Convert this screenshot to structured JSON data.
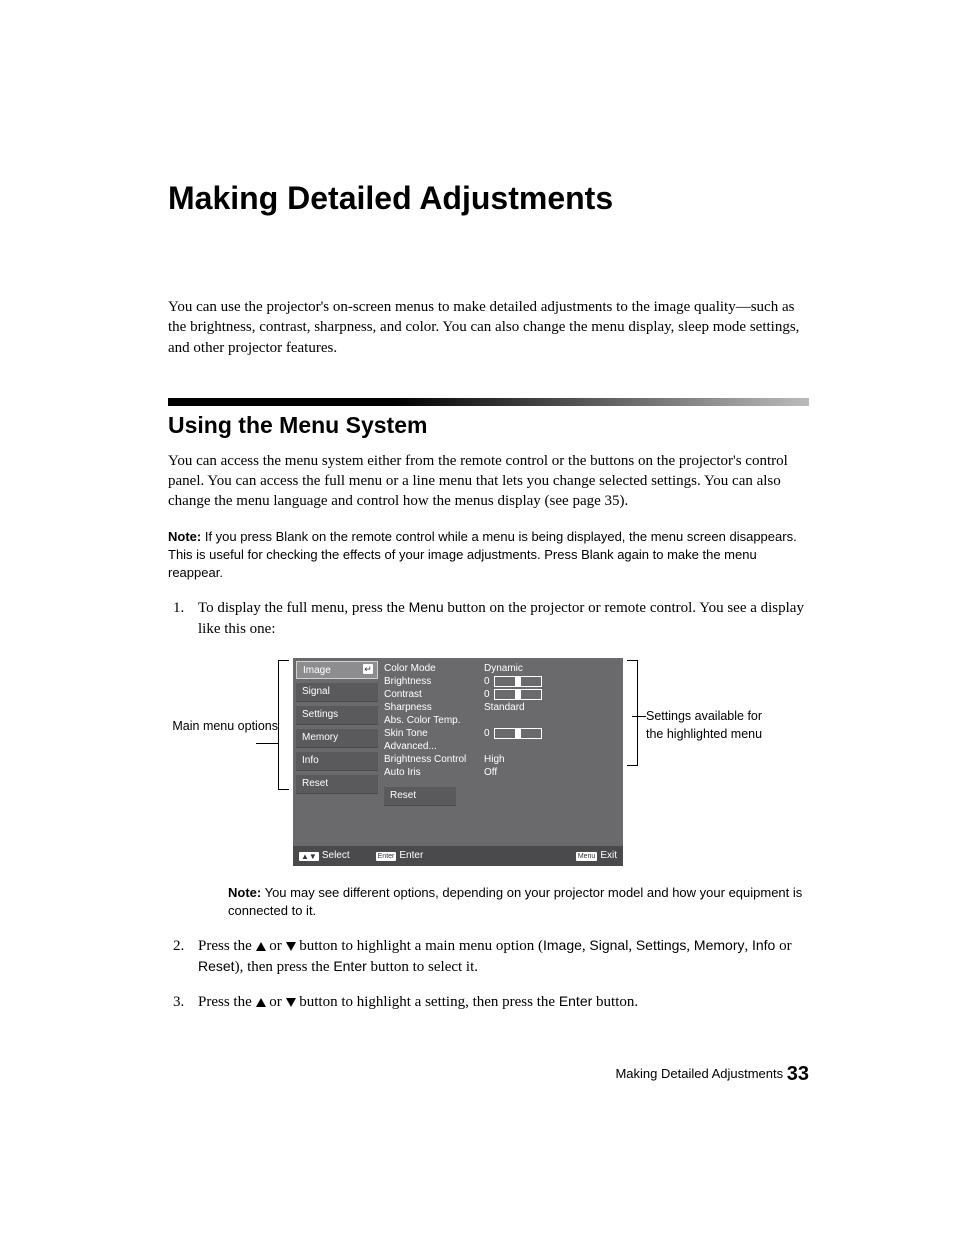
{
  "h1": "Making Detailed Adjustments",
  "intro": "You can use the projector's on-screen menus to make detailed adjustments to the image quality—such as the brightness, contrast, sharpness, and color. You can also change the menu display, sleep mode settings, and other projector features.",
  "h2": "Using the Menu System",
  "p2": "You can access the menu system either from the remote control or the buttons on the projector's control panel. You can access the full menu or a line menu that lets you change selected settings. You can also change the menu language and control how the menus display (see page 35).",
  "note1_label": "Note:",
  "note1_a": " If you press ",
  "note1_b": "Blank",
  "note1_c": " on the remote control while a menu is being displayed, the menu screen disappears. This is useful for checking the effects of your image adjustments. Press ",
  "note1_d": "Blank",
  "note1_e": " again to make the menu reappear.",
  "step1_a": "To display the full menu, press the ",
  "step1_menu": "Menu",
  "step1_b": " button on the projector or remote control. You see a display like this one:",
  "callout_left": "Main menu options",
  "callout_right": "Settings available for the highlighted menu",
  "menu": {
    "left": [
      "Image",
      "Signal",
      "Settings",
      "Memory",
      "Info",
      "Reset"
    ],
    "rows": [
      {
        "label": "Color Mode",
        "val": "Dynamic"
      },
      {
        "label": "Brightness",
        "val": "0",
        "slider": true
      },
      {
        "label": "Contrast",
        "val": "0",
        "slider": true
      },
      {
        "label": "Sharpness",
        "val": "Standard"
      },
      {
        "label": "Abs. Color Temp.",
        "val": ""
      },
      {
        "label": "Skin Tone",
        "val": "0",
        "slider": true
      },
      {
        "label": "Advanced...",
        "val": ""
      },
      {
        "label": "Brightness Control",
        "val": "High"
      },
      {
        "label": "Auto Iris",
        "val": "Off"
      }
    ],
    "reset": "Reset",
    "footer": {
      "select": "Select",
      "enter": "Enter",
      "exit": "Exit",
      "enter_box": "Enter",
      "menu_box": "Menu"
    }
  },
  "note2_label": "Note:",
  "note2": " You may see different options, depending on your projector model and how your equipment is connected to it.",
  "step2_a": "Press the ",
  "step2_b": " or ",
  "step2_c": " button to highlight a main menu option (",
  "step2_opts": [
    "Image",
    "Signal",
    "Settings",
    "Memory",
    "Info",
    "Reset"
  ],
  "step2_sep": [
    ", ",
    ", ",
    ", ",
    ", ",
    " or "
  ],
  "step2_d": "), then press the ",
  "step2_enter": "Enter",
  "step2_e": " button to select it.",
  "step3_a": "Press the ",
  "step3_b": " or ",
  "step3_c": " button to highlight a setting, then press the ",
  "step3_enter": "Enter",
  "step3_d": " button.",
  "footer_text": "Making Detailed Adjustments",
  "page_num": "33"
}
